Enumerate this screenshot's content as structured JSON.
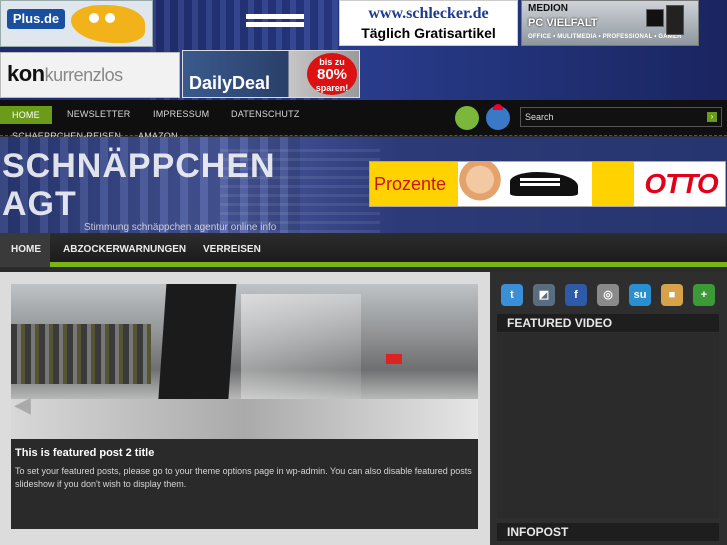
{
  "banners": {
    "plus": {
      "logo": "Plus.de"
    },
    "schlecker": {
      "line1": "www.schlecker.de",
      "line2": "Täglich Gratisartikel"
    },
    "medion": {
      "brand": "MEDION",
      "headline": "PC VIELFALT",
      "sub": "OFFICE • MULITMEDIA • PROFESSIONAL • GAMER"
    },
    "konkurrenzlos": {
      "part1": "kon",
      "part2": "kurrenzlos"
    },
    "dailydeal": {
      "title": "DailyDeal",
      "badge_top": "bis zu",
      "badge_pct": "80%",
      "badge_bottom": "sparen!"
    }
  },
  "topnav": {
    "items": [
      "HOME",
      "NEWSLETTER",
      "IMPRESSUM",
      "DATENSCHUTZ",
      "SCHAEPRCHEN-REISEN",
      "AMAZON"
    ],
    "search_placeholder": "Search"
  },
  "header": {
    "title": "SCHNÄPPCHEN AGT",
    "tagline": "Stimmung schnäppchen agentur online info"
  },
  "otto_ad": {
    "left": "Prozente",
    "brand": "OTTO"
  },
  "mainnav": {
    "items": [
      "HOME",
      "ABZOCKERWARNUNGEN",
      "VERREISEN"
    ]
  },
  "featured": {
    "title": "This is featured post 2 title",
    "text": "To set your featured posts, please go to your theme options page in wp-admin. You can also disable featured posts slideshow if you don't wish to display them."
  },
  "sidebar": {
    "share_icons": [
      {
        "name": "twitter-icon",
        "glyph": "t",
        "color": "#3b8fd6"
      },
      {
        "name": "delicious-icon",
        "glyph": "◩",
        "color": "#5a6d80"
      },
      {
        "name": "facebook-icon",
        "glyph": "f",
        "color": "#2f5aa8"
      },
      {
        "name": "technorati-icon",
        "glyph": "◎",
        "color": "#8a8a8a"
      },
      {
        "name": "stumbleupon-icon",
        "glyph": "su",
        "color": "#2a8fd0"
      },
      {
        "name": "myspace-icon",
        "glyph": "■",
        "color": "#d8a24a"
      },
      {
        "name": "addthis-icon",
        "glyph": "+",
        "color": "#3b9a35"
      }
    ],
    "featured_video_title": "FEATURED VIDEO",
    "infopost_title": "INFOPOST"
  }
}
